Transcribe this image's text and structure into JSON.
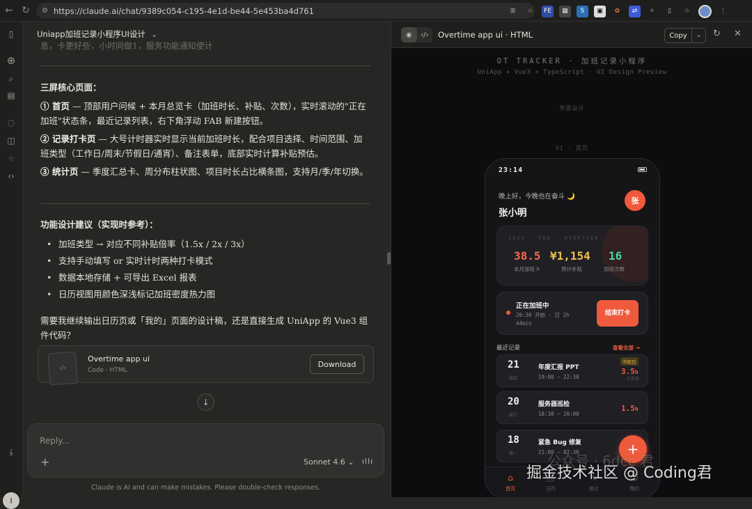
{
  "browser": {
    "url": "https://claude.ai/chat/9389c054-c195-4e1d-be44-5e453ba4d761"
  },
  "chat": {
    "title": "Uniapp加班记录小程序UI设计",
    "top_fade": "息，卡更好些，小时间做1，服务功能通知使计",
    "screens_heading": "三屏核心页面：",
    "screen1_label": "① 首页",
    "screen1_text": " — 顶部用户问候 + 本月总览卡（加班时长、补贴、次数），实时滚动的\"正在加班\"状态条，最近记录列表，右下角浮动 FAB 新建按钮。",
    "screen2_label": "② 记录打卡页",
    "screen2_text": " — 大号计时器实时显示当前加班时长，配合项目选择、时间范围、加班类型（工作日/周末/节假日/通宵）、备注表单，底部实时计算补贴预估。",
    "screen3_label": "③ 统计页",
    "screen3_text": " — 季度汇总卡、周分布柱状图、项目时长占比横条图，支持月/季/年切换。",
    "advice_heading": "功能设计建议（实现时参考）：",
    "advice": [
      "加班类型 → 对应不同补贴倍率（1.5x / 2x / 3x）",
      "支持手动填写 or 实时计时两种打卡模式",
      "数据本地存储 + 可导出 Excel 报表",
      "日历视图用颜色深浅标记加班密度热力图"
    ],
    "question": "需要我继续输出日历页或「我的」页面的设计稿，还是直接生成 UniApp 的 Vue3 组件代码？",
    "file_card": {
      "name": "Overtime app ui",
      "meta": "Code · HTML",
      "download_label": "Download"
    },
    "reply_placeholder": "Reply...",
    "model_label": "Sonnet 4.6",
    "disclaimer": "Claude is AI and can make mistakes. Please double-check responses.",
    "user_initial": "I"
  },
  "artifact": {
    "title": "Overtime app ui · HTML",
    "copy_label": "Copy",
    "brand": "OT TRACKER · 加班记录小程序",
    "brand_sub": "UniApp + Vue3 + TypeScript · UI Design Preview",
    "section_label": "界面设计",
    "page_label": "01 · 首页",
    "phone": {
      "time": "23:14",
      "greeting": "晚上好，今晚也在奋斗 🌙",
      "username": "张小明",
      "avatar_char": "张",
      "overview_tag": "2025 · FEB · OVERVIEW",
      "stats": [
        {
          "value": "38.5",
          "label": "本月加班 h",
          "color": "#f26b4a"
        },
        {
          "value": "¥1,154",
          "label": "预计补贴",
          "color": "#f0c24a"
        },
        {
          "value": "16",
          "label": "加班次数",
          "color": "#4fd6a8"
        }
      ],
      "live_title": "正在加班中",
      "live_sub": "20:30 开始 · 已 2h 44min",
      "end_button": "结束打卡",
      "records_heading": "最近记录",
      "records_all": "查看全部 →",
      "records": [
        {
          "day": "21",
          "week": "周四",
          "title": "年度汇报 PPT",
          "time": "19:00 – 22:30",
          "hours": "3.5",
          "unit": "h",
          "tag": "节假日",
          "type": "工作日"
        },
        {
          "day": "20",
          "week": "周三",
          "title": "服务器巡检",
          "time": "18:30 – 20:00",
          "hours": "1.5",
          "unit": "h",
          "tag": "",
          "type": ""
        },
        {
          "day": "18",
          "week": "周一",
          "title": "紧急 Bug 修复",
          "time": "21:00 – 02:30",
          "hours": "",
          "unit": "",
          "tag": "",
          "type": ""
        }
      ],
      "fab": "+",
      "tabs": [
        {
          "label": "首页",
          "icon": "⌂"
        },
        {
          "label": "日历",
          "icon": "▢"
        },
        {
          "label": "统计",
          "icon": "∿"
        },
        {
          "label": "我的",
          "icon": "☺"
        }
      ]
    }
  },
  "watermark": {
    "main": "掘金技术社区 @ Coding君",
    "faded": "公众号 · 6dcc 君"
  }
}
